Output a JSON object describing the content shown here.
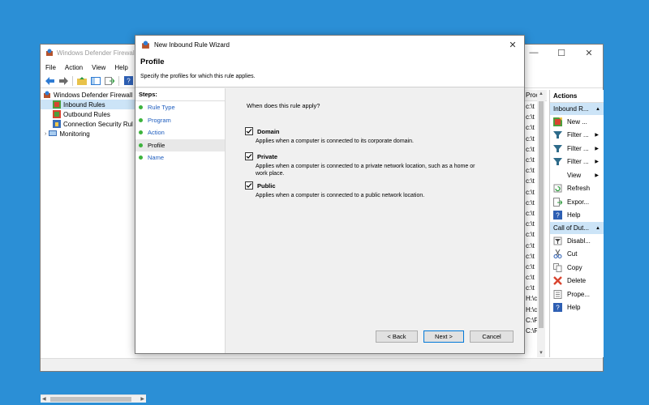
{
  "mmc": {
    "title": "Windows Defender Firewall",
    "menu": [
      "File",
      "Action",
      "View",
      "Help"
    ],
    "tree": [
      {
        "label": "Windows Defender Firewall",
        "level": 0,
        "selected": false
      },
      {
        "label": "Inbound Rules",
        "level": 1,
        "selected": true
      },
      {
        "label": "Outbound Rules",
        "level": 1,
        "selected": false
      },
      {
        "label": "Connection Security Rul",
        "level": 1,
        "selected": false
      },
      {
        "label": "Monitoring",
        "level": 1,
        "selected": false
      }
    ],
    "middle_header": "Proc",
    "middle_rows": [
      "c:\\t",
      "c:\\t",
      "c:\\t",
      "c:\\t",
      "c:\\t",
      "c:\\t",
      "c:\\t",
      "c:\\t",
      "c:\\t",
      "c:\\t",
      "c:\\t",
      "c:\\t",
      "c:\\t",
      "c:\\t",
      "c:\\t",
      "c:\\t",
      "c:\\t",
      "c:\\t",
      "H:\\c",
      "H:\\c",
      "C:\\P",
      "C:\\P"
    ],
    "actions_title": "Actions",
    "action_group_1": "Inbound R...",
    "actions_1": [
      {
        "label": "New ...",
        "icon": "new-rule-icon",
        "arrow": false
      },
      {
        "label": "Filter ...",
        "icon": "filter-icon",
        "arrow": true
      },
      {
        "label": "Filter ...",
        "icon": "filter-icon",
        "arrow": true
      },
      {
        "label": "Filter ...",
        "icon": "filter-icon",
        "arrow": true
      },
      {
        "label": "View",
        "icon": "",
        "arrow": true
      },
      {
        "label": "Refresh",
        "icon": "refresh-icon",
        "arrow": false
      },
      {
        "label": "Expor...",
        "icon": "export-icon",
        "arrow": false
      },
      {
        "label": "Help",
        "icon": "help-icon",
        "arrow": false
      }
    ],
    "action_group_2": "Call of Dut...",
    "actions_2": [
      {
        "label": "Disabl...",
        "icon": "disable-icon"
      },
      {
        "label": "Cut",
        "icon": "cut-icon"
      },
      {
        "label": "Copy",
        "icon": "copy-icon"
      },
      {
        "label": "Delete",
        "icon": "delete-icon"
      },
      {
        "label": "Prope...",
        "icon": "properties-icon"
      },
      {
        "label": "Help",
        "icon": "help-icon"
      }
    ]
  },
  "wizard": {
    "title": "New Inbound Rule Wizard",
    "header_title": "Profile",
    "header_subtitle": "Specify the profiles for which this rule applies.",
    "steps_title": "Steps:",
    "steps": [
      {
        "label": "Rule Type",
        "current": false
      },
      {
        "label": "Program",
        "current": false
      },
      {
        "label": "Action",
        "current": false
      },
      {
        "label": "Profile",
        "current": true
      },
      {
        "label": "Name",
        "current": false
      }
    ],
    "question": "When does this rule apply?",
    "options": [
      {
        "label": "Domain",
        "checked": true,
        "desc": "Applies when a computer is connected to its corporate domain."
      },
      {
        "label": "Private",
        "checked": true,
        "desc": "Applies when a computer is connected to a private network location, such as a home or work place."
      },
      {
        "label": "Public",
        "checked": true,
        "desc": "Applies when a computer is connected to a public network location."
      }
    ],
    "buttons": {
      "back": "< Back",
      "next": "Next >",
      "cancel": "Cancel"
    }
  },
  "colors": {
    "desktop": "#2b8fd6",
    "selection": "#cce4f7",
    "link": "#1e5dbe",
    "step_dot": "#3db33d"
  }
}
